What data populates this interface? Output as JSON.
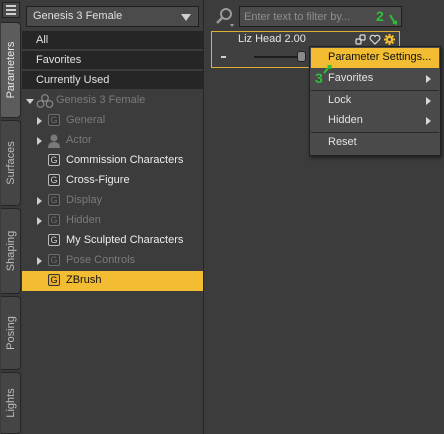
{
  "tabs": [
    "Parameters",
    "Surfaces",
    "Shaping",
    "Posing",
    "Lights"
  ],
  "figure_select": {
    "value": "Genesis 3 Female"
  },
  "filters": [
    "All",
    "Favorites",
    "Currently Used"
  ],
  "tree": {
    "root": "Genesis 3 Female",
    "items": [
      {
        "label": "General",
        "dim": true,
        "expandable": true
      },
      {
        "label": "Actor",
        "dim": true,
        "expandable": true
      },
      {
        "label": "Commission Characters",
        "dim": false,
        "expandable": false
      },
      {
        "label": "Cross-Figure",
        "dim": false,
        "expandable": false
      },
      {
        "label": "Display",
        "dim": true,
        "expandable": true
      },
      {
        "label": "Hidden",
        "dim": true,
        "expandable": true
      },
      {
        "label": "My Sculpted Characters",
        "dim": false,
        "expandable": false
      },
      {
        "label": "Pose Controls",
        "dim": true,
        "expandable": true
      },
      {
        "label": "ZBrush",
        "dim": false,
        "expandable": false,
        "selected": true
      }
    ],
    "group_icon_glyph": "G"
  },
  "filter_input": {
    "placeholder": "Enter text to filter by..."
  },
  "callouts": [
    "2",
    "3"
  ],
  "parameter": {
    "title": "Liz Head 2.00",
    "slider_level": 0.85
  },
  "context_menu": {
    "items": [
      {
        "label": "Parameter Settings...",
        "highlight": true,
        "submenu": false
      },
      {
        "label": "Favorites",
        "submenu": true
      },
      {
        "label": "Lock",
        "submenu": true
      },
      {
        "label": "Hidden",
        "submenu": true
      },
      {
        "label": "Reset",
        "submenu": false
      }
    ]
  },
  "colors": {
    "accent": "#f2bd33",
    "callout": "#2fbf3a",
    "background": "#3c3c3c"
  }
}
